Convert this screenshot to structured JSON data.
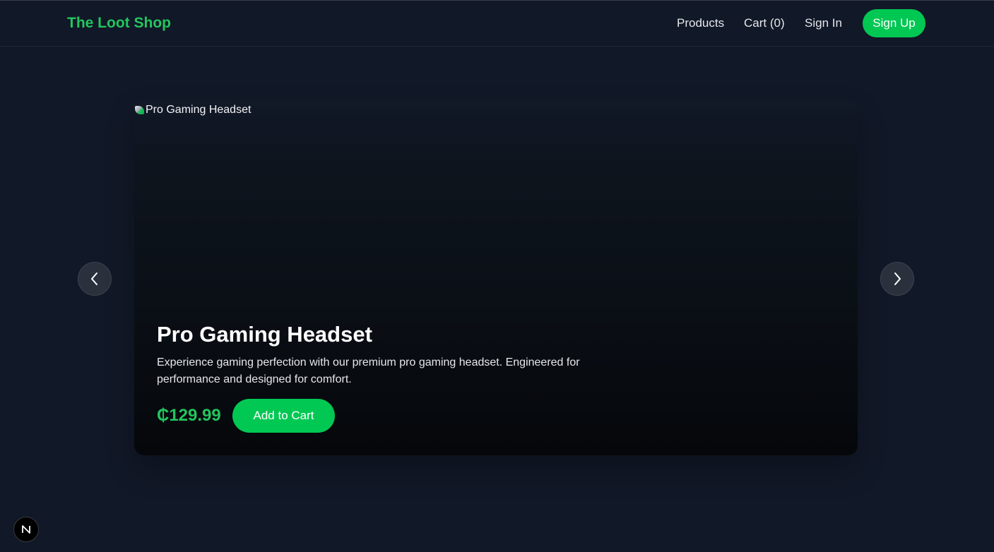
{
  "header": {
    "logo": "The Loot Shop",
    "nav": {
      "products": "Products",
      "cart": "Cart (0)",
      "sign_in": "Sign In",
      "sign_up": "Sign Up"
    }
  },
  "carousel": {
    "slide": {
      "image_alt": "Pro Gaming Headset",
      "title": "Pro Gaming Headset",
      "description": "Experience gaming perfection with our premium pro gaming headset. Engineered for performance and designed for comfort.",
      "price": "₵129.99",
      "add_to_cart": "Add to Cart"
    },
    "prev_icon": "chevron-left-icon",
    "next_icon": "chevron-right-icon"
  },
  "dev_badge": {
    "letter": "N",
    "icon": "nextjs-icon"
  },
  "colors": {
    "background": "#111827",
    "accent": "#00c853",
    "logo": "#22c55e"
  }
}
